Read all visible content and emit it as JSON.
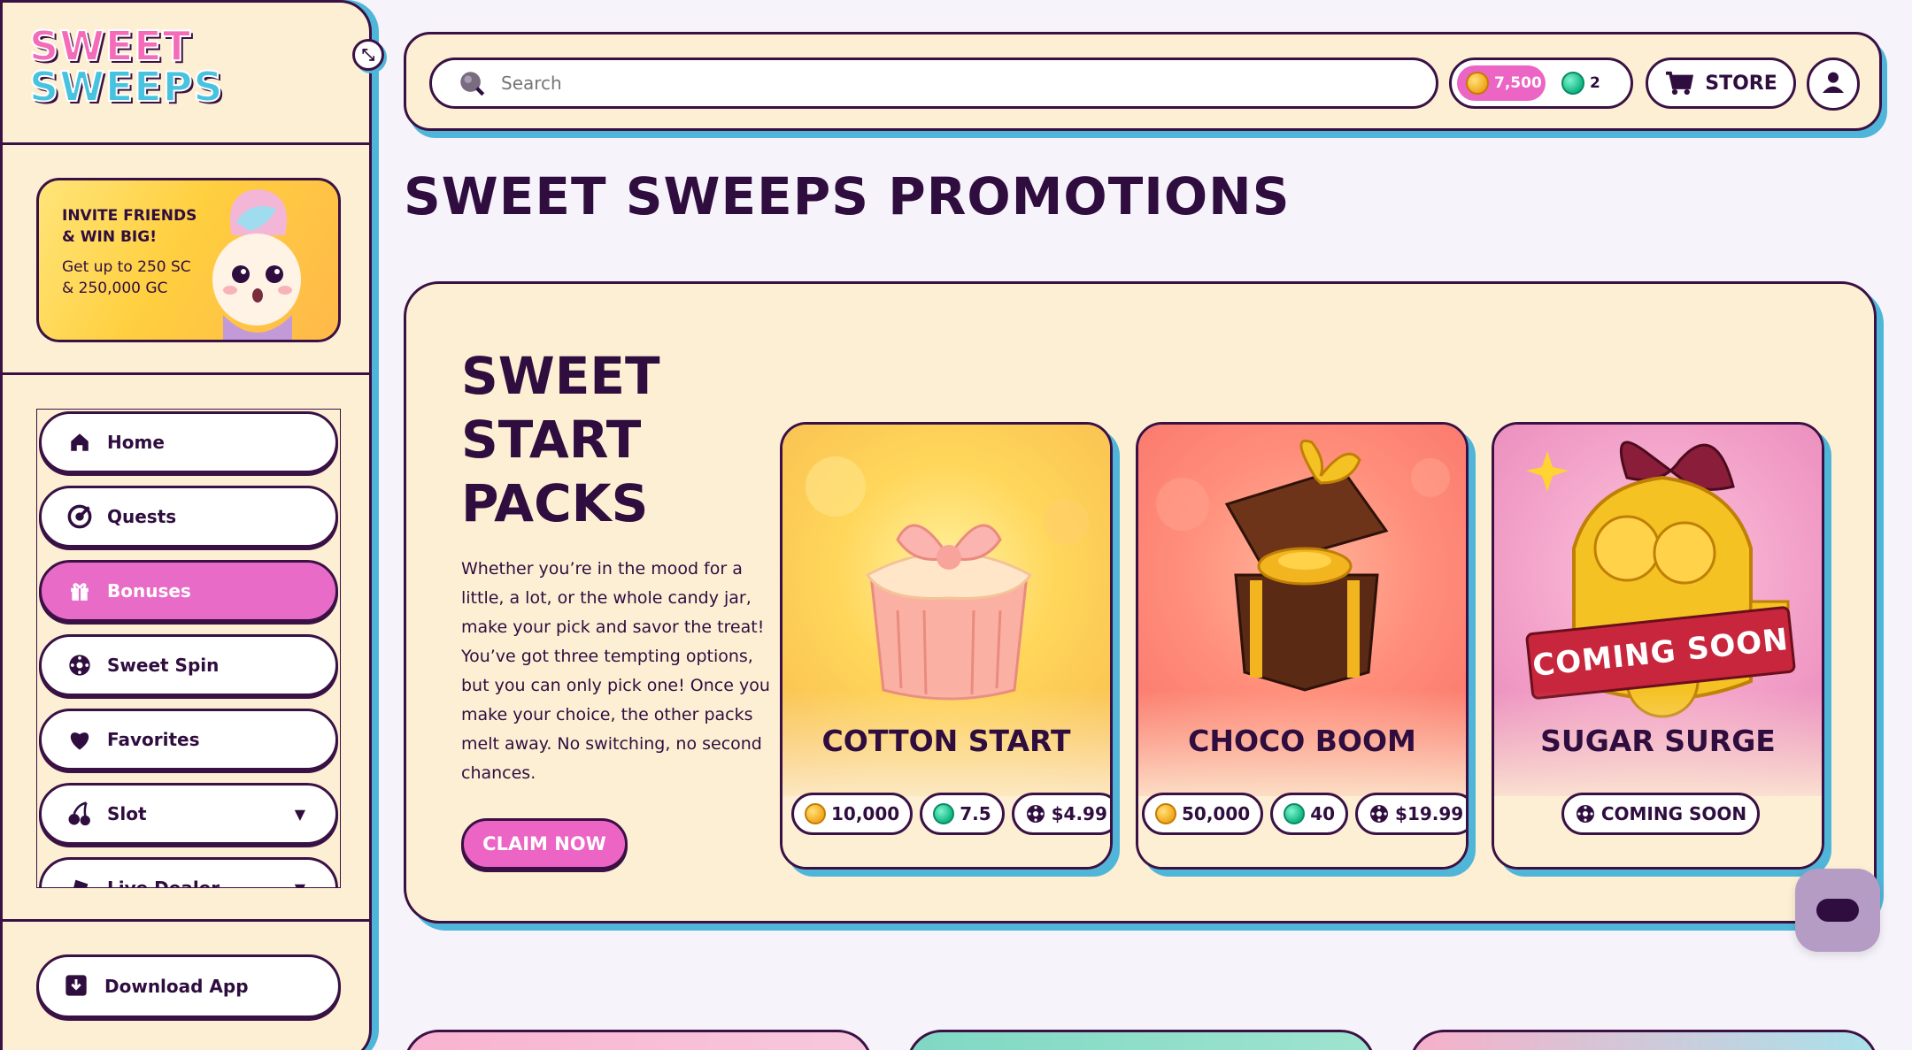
{
  "brand": {
    "line1": "SWEET",
    "line2": "SWEEPS"
  },
  "sidebar": {
    "promo": {
      "title": "INVITE FRIENDS & WIN BIG!",
      "subtitle": "Get up to 250 SC & 250,000 GC"
    },
    "items": [
      {
        "label": "Home",
        "icon": "home-icon"
      },
      {
        "label": "Quests",
        "icon": "quests-icon"
      },
      {
        "label": "Bonuses",
        "icon": "gift-icon",
        "active": true
      },
      {
        "label": "Sweet Spin",
        "icon": "spin-wheel-icon"
      },
      {
        "label": "Favorites",
        "icon": "heart-icon"
      },
      {
        "label": "Slot",
        "icon": "cherry-icon",
        "expandable": true
      },
      {
        "label": "Live Dealer",
        "icon": "dealer-icon",
        "expandable": true
      }
    ],
    "download_label": "Download App"
  },
  "topbar": {
    "search_placeholder": "Search",
    "gc_balance": "7,500",
    "sc_balance": "2",
    "store_label": "STORE"
  },
  "page_title": "SWEET SWEEPS PROMOTIONS",
  "promo_section": {
    "heading": "SWEET START PACKS",
    "description": "Whether you’re in the mood for a little, a lot, or the whole candy jar, make your pick and savor the treat! You’ve got three tempting options, but you can only pick one! Once you make your choice, the other packs melt away. No switching, no second chances.",
    "claim_label": "CLAIM NOW",
    "packs": [
      {
        "name": "COTTON START",
        "gc": "10,000",
        "sc": "7.5",
        "price": "$4.99"
      },
      {
        "name": "CHOCO BOOM",
        "gc": "50,000",
        "sc": "40",
        "price": "$19.99"
      },
      {
        "name": "SUGAR SURGE",
        "status": "COMING SOON",
        "ribbon": "COMING SOON"
      }
    ]
  },
  "colors": {
    "ink": "#2f0d3f",
    "accent_pink": "#ec64c4",
    "shadow_blue": "#4fb6d9",
    "cream": "#fdefd4"
  }
}
